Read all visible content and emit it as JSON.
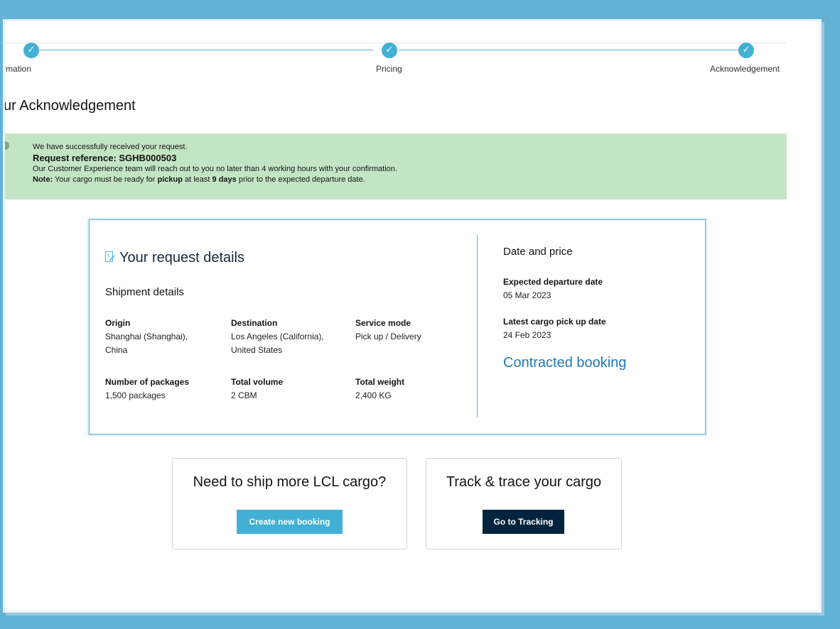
{
  "stepper": {
    "steps": [
      {
        "label": "rmation"
      },
      {
        "label": "Pricing"
      },
      {
        "label": "Acknowledgement"
      }
    ],
    "check_glyph": "✓"
  },
  "page": {
    "title": "ur Acknowledgement"
  },
  "banner": {
    "line1": "We have successfully received your request.",
    "reference": "Request reference: SGHB000503",
    "line3": "Our Customer Experience team will reach out to you no later than 4 working hours with your confirmation.",
    "note_label": "Note:",
    "note_1": " Your cargo must be ready for ",
    "note_pickup": "pickup",
    "note_2": " at least ",
    "note_days": "9 days",
    "note_3": " prior to the expected departure date.",
    "color": "#c3e5c3"
  },
  "request": {
    "title": "Your request details",
    "icon": "document-pen-icon",
    "shipment_heading": "Shipment details",
    "fields": [
      {
        "label": "Origin",
        "value": "Shanghai (Shanghai),\nChina"
      },
      {
        "label": "Destination",
        "value": "Los Angeles (California),\nUnited States"
      },
      {
        "label": "Service mode",
        "value": "Pick up / Delivery"
      },
      {
        "label": "Number of packages",
        "value": "1,500 packages"
      },
      {
        "label": "Total volume",
        "value": "2 CBM"
      },
      {
        "label": "Total weight",
        "value": "2,400 KG"
      }
    ],
    "side_heading": "Date and price",
    "departure_label": "Expected departure date",
    "departure_value": "05 Mar 2023",
    "pickup_label": "Latest cargo pick up date",
    "pickup_value": "24 Feb 2023",
    "booking_type": "Contracted booking"
  },
  "tiles": {
    "ship_more_title": "Need to ship more LCL cargo?",
    "create_button": "Create new booking",
    "track_title": "Track & trace your cargo",
    "tracking_button": "Go to Tracking"
  },
  "colors": {
    "accent": "#42b0d5",
    "dark_button": "#00243d",
    "link_blue": "#217ab0",
    "background": "#62b2d6"
  }
}
